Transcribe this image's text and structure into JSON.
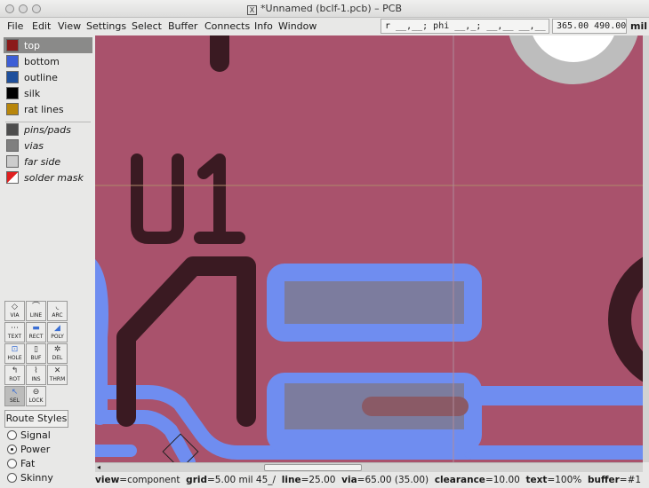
{
  "window": {
    "title": "*Unnamed (bclf-1.pcb) – PCB"
  },
  "menu": [
    {
      "label": "File"
    },
    {
      "label": "Edit"
    },
    {
      "label": "View"
    },
    {
      "label": "Settings"
    },
    {
      "label": "Select"
    },
    {
      "label": "Buffer"
    },
    {
      "label": "Connects"
    },
    {
      "label": "Info"
    },
    {
      "label": "Window"
    }
  ],
  "status_fields": {
    "relative": "r __,__; phi __,_; __,__ __,__",
    "coords": "365.00 490.00",
    "units": "mil"
  },
  "layers": [
    {
      "label": "top",
      "color": "#8b1a1a",
      "selected": true
    },
    {
      "label": "bottom",
      "color": "#3d5ed6"
    },
    {
      "label": "outline",
      "color": "#1e4f9c"
    },
    {
      "label": "silk",
      "color": "#000000"
    },
    {
      "label": "rat lines",
      "color": "#b8860b"
    },
    {
      "label": "pins/pads",
      "color": "#4d4d4d"
    },
    {
      "label": "vias",
      "color": "#7f7f7f"
    },
    {
      "label": "far side",
      "color": "#cccccc"
    },
    {
      "label": "solder mask",
      "color": "#ffffff"
    }
  ],
  "tools": [
    {
      "label": "VIA",
      "icon": "via-icon"
    },
    {
      "label": "LINE",
      "icon": "line-icon"
    },
    {
      "label": "ARC",
      "icon": "arc-icon"
    },
    {
      "label": "TEXT",
      "icon": "text-icon"
    },
    {
      "label": "RECT",
      "icon": "rect-icon"
    },
    {
      "label": "POLY",
      "icon": "poly-icon"
    },
    {
      "label": "HOLE",
      "icon": "hole-icon"
    },
    {
      "label": "BUF",
      "icon": "buffer-icon"
    },
    {
      "label": "DEL",
      "icon": "delete-icon"
    },
    {
      "label": "ROT",
      "icon": "rotate-icon"
    },
    {
      "label": "INS",
      "icon": "insert-icon"
    },
    {
      "label": "THRM",
      "icon": "thermal-icon"
    },
    {
      "label": "SEL",
      "icon": "select-icon",
      "active": true
    },
    {
      "label": "LOCK",
      "icon": "lock-icon"
    }
  ],
  "route_styles": {
    "button_label": "Route Styles",
    "options": [
      {
        "label": "Signal",
        "selected": false
      },
      {
        "label": "Power",
        "selected": true
      },
      {
        "label": "Fat",
        "selected": false
      },
      {
        "label": "Skinny",
        "selected": false
      }
    ]
  },
  "canvas": {
    "silk_text": "U1",
    "colors": {
      "board": "#a9526c",
      "top_copper": "#3a1a22",
      "bottom_copper": "#6f8df0",
      "pad": "#7c7c9e"
    }
  },
  "statusbar": {
    "view": "component",
    "grid": "5.00 mil",
    "angle": "45_/",
    "line": "25.00",
    "via": "65.00 (35.00)",
    "clearance": "10.00",
    "text": "100%",
    "buffer": "#1"
  }
}
